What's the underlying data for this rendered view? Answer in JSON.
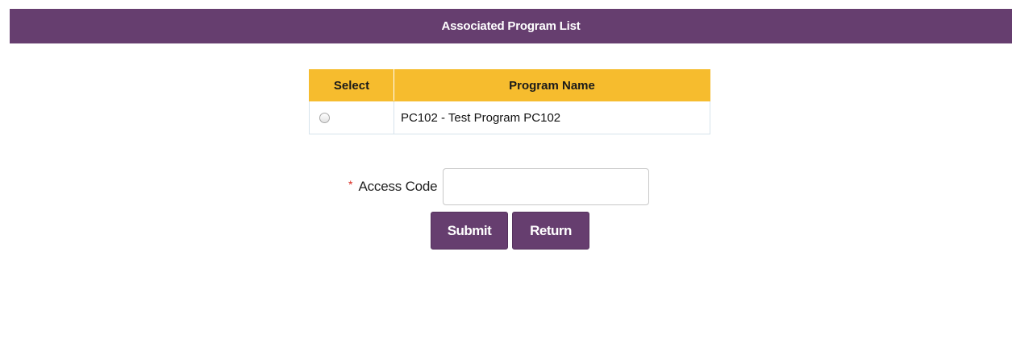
{
  "header": {
    "title": "Associated Program List"
  },
  "table": {
    "columns": [
      "Select",
      "Program Name"
    ],
    "rows": [
      {
        "selected": false,
        "program_name": "PC102 - Test Program PC102"
      }
    ]
  },
  "form": {
    "required_marker": "*",
    "access_code_label": "Access Code",
    "access_code_value": "",
    "submit_label": "Submit",
    "return_label": "Return"
  },
  "colors": {
    "brand": "#663e6f",
    "table_header": "#f6bc2e",
    "required": "#d9261c"
  }
}
